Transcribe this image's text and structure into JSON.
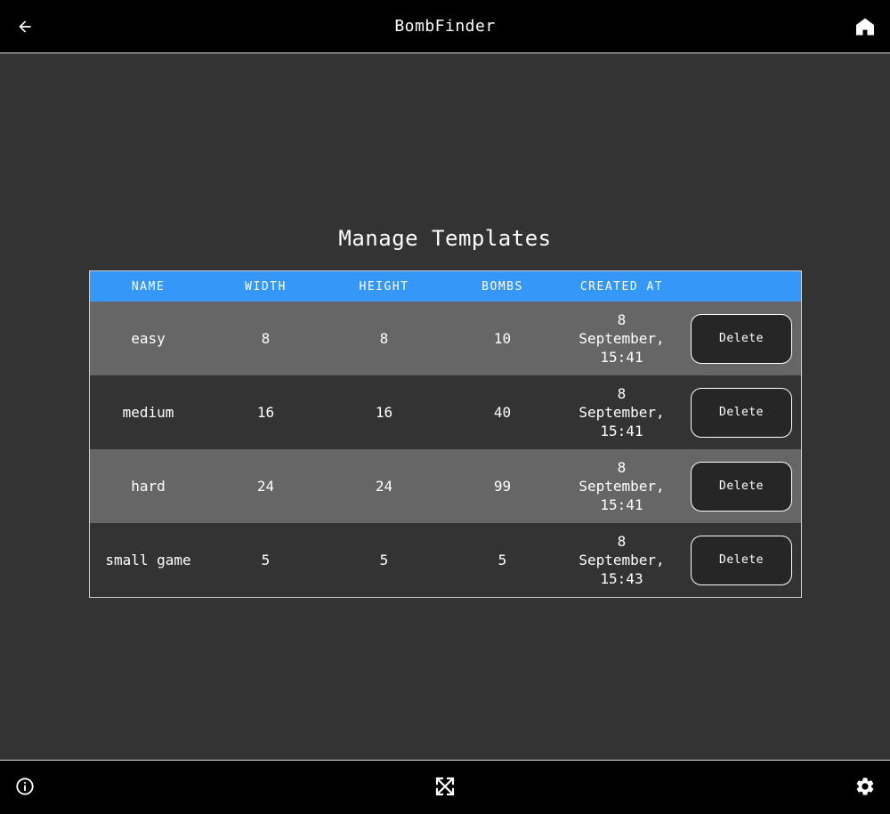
{
  "app": {
    "title": "BombFinder"
  },
  "header": {
    "back_icon": "arrow-left-icon",
    "home_icon": "home-icon"
  },
  "page": {
    "title": "Manage Templates"
  },
  "table": {
    "columns": [
      "NAME",
      "WIDTH",
      "HEIGHT",
      "BOMBS",
      "CREATED AT",
      ""
    ],
    "rows": [
      {
        "name": "easy",
        "width": "8",
        "height": "8",
        "bombs": "10",
        "created_at": "8\nSeptember,\n15:41",
        "action": "Delete"
      },
      {
        "name": "medium",
        "width": "16",
        "height": "16",
        "bombs": "40",
        "created_at": "8\nSeptember,\n15:41",
        "action": "Delete"
      },
      {
        "name": "hard",
        "width": "24",
        "height": "24",
        "bombs": "99",
        "created_at": "8\nSeptember,\n15:41",
        "action": "Delete"
      },
      {
        "name": "small game",
        "width": "5",
        "height": "5",
        "bombs": "5",
        "created_at": "8\nSeptember,\n15:43",
        "action": "Delete"
      }
    ]
  },
  "footer": {
    "info_icon": "info-icon",
    "fullscreen_icon": "fullscreen-icon",
    "settings_icon": "gear-icon"
  },
  "colors": {
    "background": "#333333",
    "bar": "#000000",
    "header_accent": "#3597f7",
    "row_alt": "#666666"
  }
}
